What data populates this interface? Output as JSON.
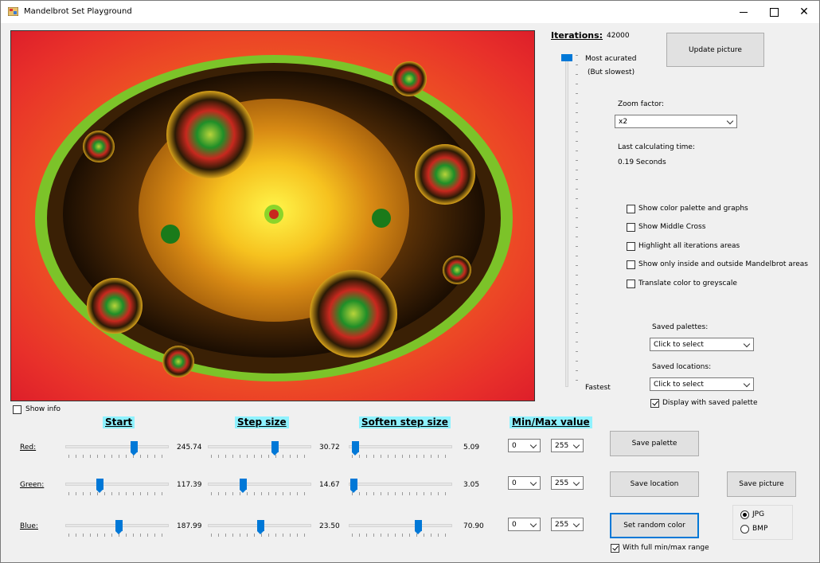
{
  "window": {
    "title": "Mandelbrot Set Playground"
  },
  "iterations": {
    "label": "Iterations:",
    "value": "42000",
    "most_label": "Most acurated",
    "most_sub": "(But slowest)",
    "least_label": "Fastest"
  },
  "update_button": "Update picture",
  "zoom": {
    "label": "Zoom factor:",
    "value": "x2"
  },
  "calc": {
    "label": "Last calculating time:",
    "value": "0.19 Seconds"
  },
  "options": [
    {
      "label": "Show color palette and graphs",
      "checked": false
    },
    {
      "label": "Show Middle Cross",
      "checked": false
    },
    {
      "label": "Highlight all iterations areas",
      "checked": false
    },
    {
      "label": "Show only inside and outside Mandelbrot areas",
      "checked": false
    },
    {
      "label": "Translate color to greyscale",
      "checked": false
    }
  ],
  "saved_palettes": {
    "label": "Saved palettes:",
    "value": "Click to select"
  },
  "saved_locations": {
    "label": "Saved locations:",
    "value": "Click to select"
  },
  "display_saved_palette": {
    "label": "Display with saved palette",
    "checked": true
  },
  "show_info": {
    "label": "Show info",
    "checked": false
  },
  "headers": {
    "start": "Start",
    "step": "Step size",
    "soften": "Soften step size",
    "minmax": "Min/Max value"
  },
  "channels": [
    {
      "name": "Red:",
      "start": "245.74",
      "step": "30.72",
      "soften": "5.09",
      "min": "0",
      "max": "255",
      "start_frac": 0.68,
      "step_frac": 0.66,
      "soften_frac": 0.03
    },
    {
      "name": "Green:",
      "start": "117.39",
      "step": "14.67",
      "soften": "3.05",
      "min": "0",
      "max": "255",
      "start_frac": 0.32,
      "step_frac": 0.33,
      "soften_frac": 0.02
    },
    {
      "name": "Blue:",
      "start": "187.99",
      "step": "23.50",
      "soften": "70.90",
      "min": "0",
      "max": "255",
      "start_frac": 0.52,
      "step_frac": 0.51,
      "soften_frac": 0.69
    }
  ],
  "buttons": {
    "save_palette": "Save  palette",
    "save_location": "Save location",
    "save_picture": "Save picture",
    "random_color": "Set random color"
  },
  "full_range": {
    "label": "With full min/max range",
    "checked": true
  },
  "format": {
    "jpg": "JPG",
    "bmp": "BMP",
    "selected": "JPG"
  },
  "colors": {
    "accent": "#0078d7",
    "header_bg": "#8ff2ff"
  }
}
